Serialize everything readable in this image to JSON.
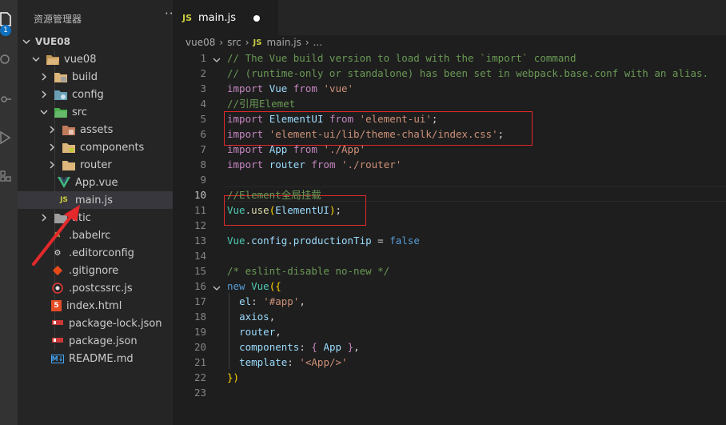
{
  "activity_bar": {
    "badge": "1"
  },
  "explorer": {
    "title": "资源管理器",
    "more": "···",
    "root": "VUE08",
    "items": [
      {
        "label": "vue08",
        "icon": "folder-open-icon"
      },
      {
        "label": "build",
        "icon": "folder-build-icon"
      },
      {
        "label": "config",
        "icon": "folder-config-icon"
      },
      {
        "label": "src",
        "icon": "folder-src-icon"
      },
      {
        "label": "assets",
        "icon": "folder-assets-icon"
      },
      {
        "label": "components",
        "icon": "folder-components-icon"
      },
      {
        "label": "router",
        "icon": "folder-icon"
      },
      {
        "label": "App.vue",
        "icon": "vue-file-icon"
      },
      {
        "label": "main.js",
        "icon": "js-file-icon",
        "badge": "JS"
      },
      {
        "label": "atic",
        "icon": "folder-static-icon"
      },
      {
        "label": ".babelrc",
        "icon": "babel-file-icon"
      },
      {
        "label": ".editorconfig",
        "icon": "editorconfig-file-icon"
      },
      {
        "label": ".gitignore",
        "icon": "git-file-icon"
      },
      {
        "label": ".postcssrc.js",
        "icon": "postcss-file-icon"
      },
      {
        "label": "index.html",
        "icon": "html-file-icon",
        "badge": "5"
      },
      {
        "label": "package-lock.json",
        "icon": "npm-file-icon"
      },
      {
        "label": "package.json",
        "icon": "npm-file-icon"
      },
      {
        "label": "README.md",
        "icon": "markdown-file-icon",
        "badge": "M↓"
      }
    ]
  },
  "tab": {
    "badge": "JS",
    "name": "main.js"
  },
  "breadcrumb": {
    "parts": [
      "vue08",
      "src",
      "main.js",
      "..."
    ],
    "js_badge": "JS"
  },
  "editor": {
    "current_line": 10,
    "lines": [
      [
        [
          "cm",
          "// The Vue build version to load with the `import` command"
        ]
      ],
      [
        [
          "cm",
          "// (runtime-only or standalone) has been set in webpack.base.conf with an alias."
        ]
      ],
      [
        [
          "kw",
          "import"
        ],
        [
          "pl",
          " "
        ],
        [
          "vr",
          "Vue"
        ],
        [
          "pl",
          " "
        ],
        [
          "kw",
          "from"
        ],
        [
          "pl",
          " "
        ],
        [
          "st",
          "'vue'"
        ]
      ],
      [
        [
          "cm",
          "//引用Elemet"
        ]
      ],
      [
        [
          "kw",
          "import"
        ],
        [
          "pl",
          " "
        ],
        [
          "vr",
          "ElementUI"
        ],
        [
          "pl",
          " "
        ],
        [
          "kw",
          "from"
        ],
        [
          "pl",
          " "
        ],
        [
          "st",
          "'element-ui'"
        ],
        [
          "pl",
          ";"
        ]
      ],
      [
        [
          "kw",
          "import"
        ],
        [
          "pl",
          " "
        ],
        [
          "st",
          "'element-ui/lib/theme-chalk/index.css'"
        ],
        [
          "pl",
          ";"
        ]
      ],
      [
        [
          "kw",
          "import"
        ],
        [
          "pl",
          " "
        ],
        [
          "vr",
          "App"
        ],
        [
          "pl",
          " "
        ],
        [
          "kw",
          "from"
        ],
        [
          "pl",
          " "
        ],
        [
          "st",
          "'./App'"
        ]
      ],
      [
        [
          "kw",
          "import"
        ],
        [
          "pl",
          " "
        ],
        [
          "vr",
          "router"
        ],
        [
          "pl",
          " "
        ],
        [
          "kw",
          "from"
        ],
        [
          "pl",
          " "
        ],
        [
          "st",
          "'./router'"
        ]
      ],
      [],
      [
        [
          "cm",
          "//Element全局挂载"
        ]
      ],
      [
        [
          "cl",
          "Vue"
        ],
        [
          "pl",
          "."
        ],
        [
          "fn",
          "use"
        ],
        [
          "br",
          "("
        ],
        [
          "vr",
          "ElementUI"
        ],
        [
          "br",
          ")"
        ],
        [
          "pl",
          ";"
        ]
      ],
      [],
      [
        [
          "cl",
          "Vue"
        ],
        [
          "pl",
          "."
        ],
        [
          "vr",
          "config"
        ],
        [
          "pl",
          "."
        ],
        [
          "vr",
          "productionTip"
        ],
        [
          "pl",
          " = "
        ],
        [
          "bl",
          "false"
        ]
      ],
      [],
      [
        [
          "cm",
          "/* eslint-disable no-new */"
        ]
      ],
      [
        [
          "bl",
          "new"
        ],
        [
          "pl",
          " "
        ],
        [
          "cl",
          "Vue"
        ],
        [
          "br",
          "({"
        ]
      ],
      [
        [
          "pl",
          "  "
        ],
        [
          "vr",
          "el"
        ],
        [
          "pl",
          ": "
        ],
        [
          "st",
          "'#app'"
        ],
        [
          "pl",
          ","
        ]
      ],
      [
        [
          "pl",
          "  "
        ],
        [
          "vr",
          "axios"
        ],
        [
          "pl",
          ","
        ]
      ],
      [
        [
          "pl",
          "  "
        ],
        [
          "vr",
          "router"
        ],
        [
          "pl",
          ","
        ]
      ],
      [
        [
          "pl",
          "  "
        ],
        [
          "vr",
          "components"
        ],
        [
          "pl",
          ": "
        ],
        [
          "kw",
          "{"
        ],
        [
          "pl",
          " "
        ],
        [
          "vr",
          "App"
        ],
        [
          "pl",
          " "
        ],
        [
          "kw",
          "}"
        ],
        [
          "pl",
          ","
        ]
      ],
      [
        [
          "pl",
          "  "
        ],
        [
          "vr",
          "template"
        ],
        [
          "pl",
          ": "
        ],
        [
          "st",
          "'<App/>'"
        ]
      ],
      [
        [
          "br",
          "})"
        ]
      ],
      []
    ],
    "fold_lines": [
      1,
      16
    ]
  },
  "colors": {
    "annotation": "#e3292b",
    "tab_badge": "#cbcb41"
  }
}
